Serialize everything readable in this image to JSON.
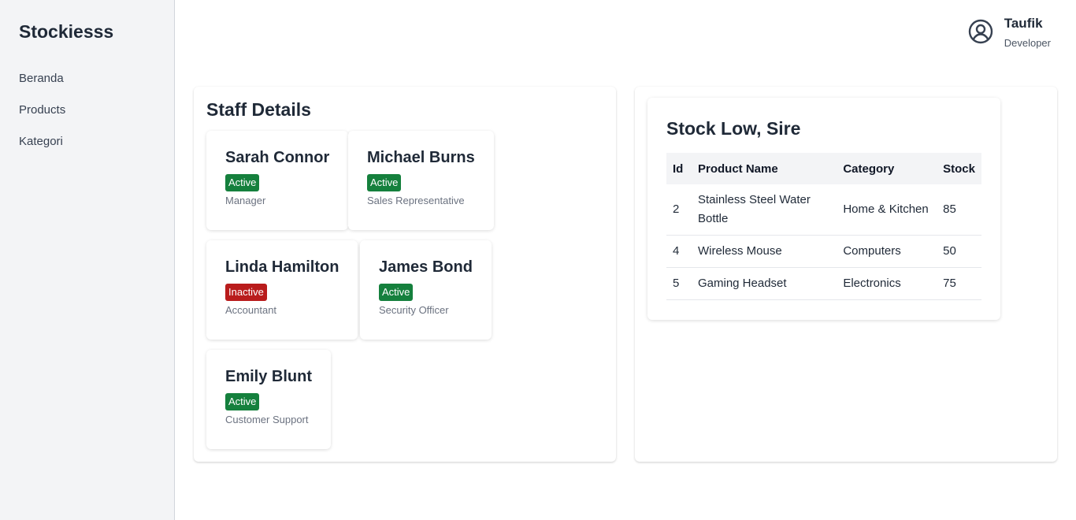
{
  "app": {
    "brand": "Stockiesss"
  },
  "sidebar": {
    "items": [
      {
        "label": "Beranda"
      },
      {
        "label": "Products"
      },
      {
        "label": "Kategori"
      }
    ]
  },
  "user": {
    "name": "Taufik",
    "role": "Developer",
    "icon": "user-circle-icon"
  },
  "staff": {
    "title": "Staff Details",
    "members": [
      {
        "name": "Sarah Connor",
        "status": "Active",
        "role": "Manager"
      },
      {
        "name": "Michael Burns",
        "status": "Active",
        "role": "Sales Representative"
      },
      {
        "name": "Linda Hamilton",
        "status": "Inactive",
        "role": "Accountant"
      },
      {
        "name": "James Bond",
        "status": "Active",
        "role": "Security Officer"
      },
      {
        "name": "Emily Blunt",
        "status": "Active",
        "role": "Customer Support"
      }
    ]
  },
  "stock": {
    "title": "Stock Low, Sire",
    "columns": [
      "Id",
      "Product Name",
      "Category",
      "Stock"
    ],
    "rows": [
      {
        "id": "2",
        "name": "Stainless Steel Water Bottle",
        "category": "Home & Kitchen",
        "stock": "85"
      },
      {
        "id": "4",
        "name": "Wireless Mouse",
        "category": "Computers",
        "stock": "50"
      },
      {
        "id": "5",
        "name": "Gaming Headset",
        "category": "Electronics",
        "stock": "75"
      }
    ]
  },
  "colors": {
    "active": "#15803d",
    "inactive": "#b91c1c",
    "sidebar_bg": "#f3f4f6"
  }
}
